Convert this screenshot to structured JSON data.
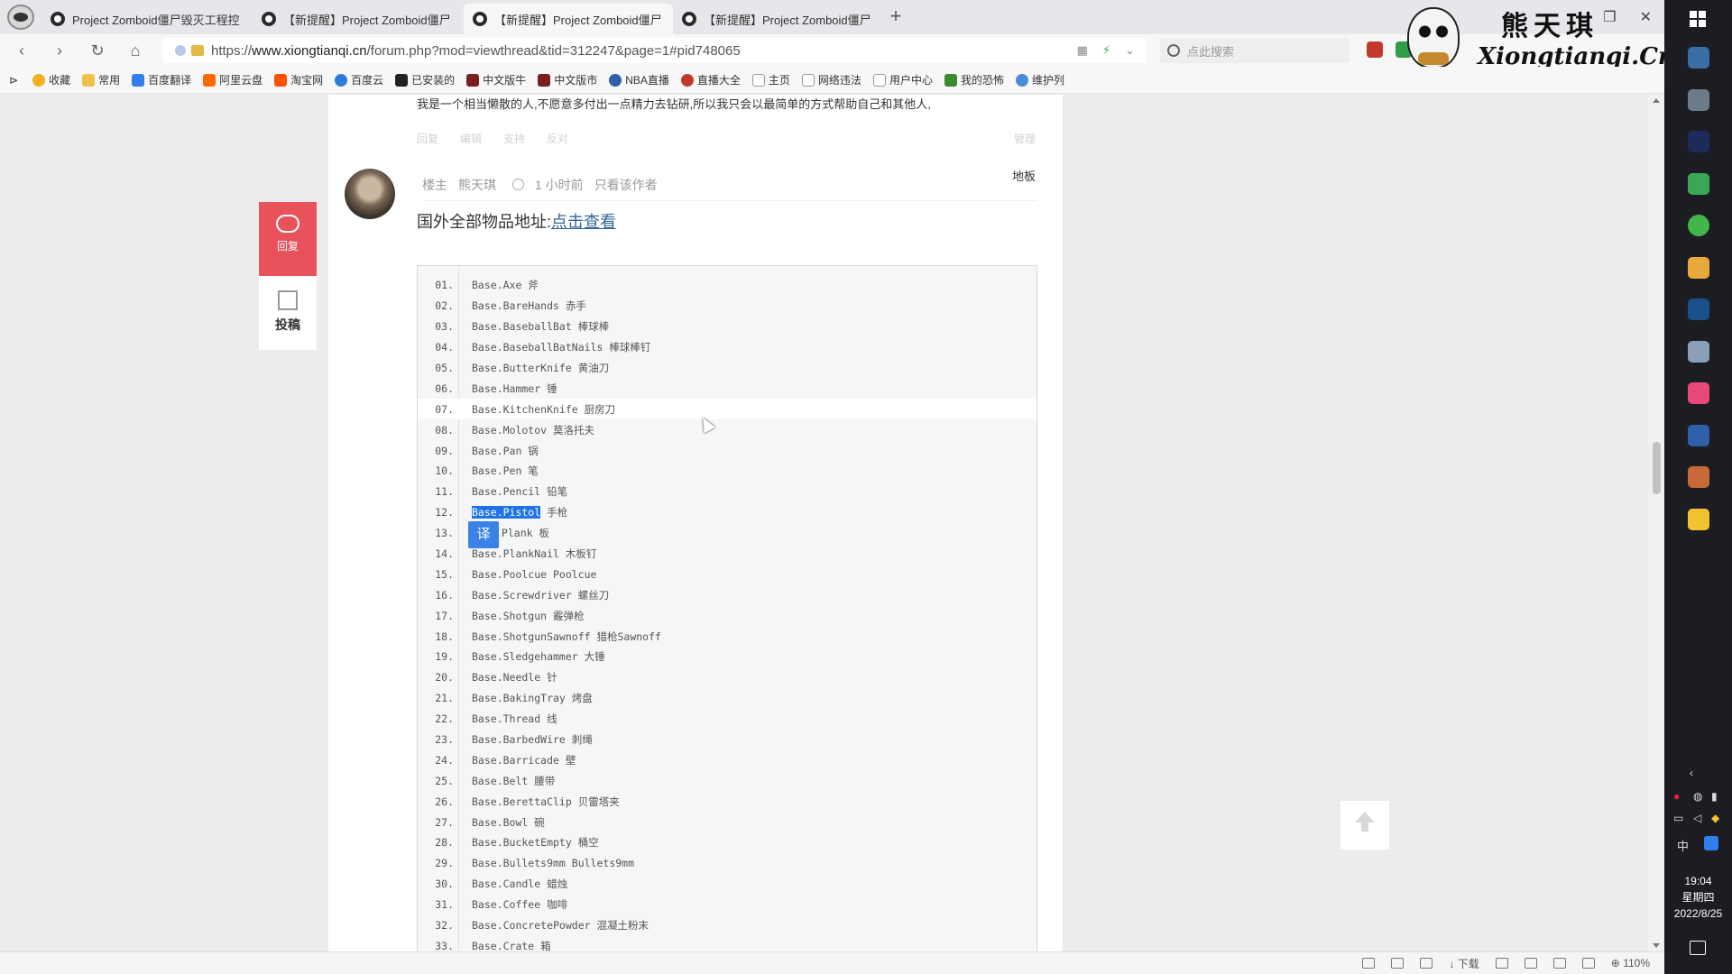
{
  "browser": {
    "tabs": [
      {
        "label": "Project Zomboid僵尸毁灭工程控"
      },
      {
        "label": "【新提醒】Project Zomboid僵尸"
      },
      {
        "label": "【新提醒】Project Zomboid僵尸"
      },
      {
        "label": "【新提醒】Project Zomboid僵尸"
      }
    ],
    "active_tab_index": 2,
    "url_host": "www.xiongtianqi.cn",
    "url_prefix": "https://",
    "url_path": "/forum.php?mod=viewthread&tid=312247&page=1#pid748065",
    "search_placeholder": "点此搜索",
    "bookmarks": [
      "收藏",
      "常用",
      "百度翻译",
      "阿里云盘",
      "淘宝网",
      "百度云",
      "已安装的",
      "中文版牛",
      "中文版市",
      "NBA直播",
      "直播大全",
      "主页",
      "网络违法",
      "用户中心",
      "我的恐怖",
      "维护列"
    ],
    "zoom": "110%",
    "download_label": "下载"
  },
  "watermark": {
    "title": "熊天琪",
    "url": "Xiongtianqi.Cn"
  },
  "page": {
    "prev_post_text": "我是一个相当懒散的人,不愿意多付出一点精力去钻研,所以我只会以最简单的方式帮助自己和其他人,",
    "prev_actions": [
      "回复",
      "编辑",
      "支持",
      "反对"
    ],
    "prev_manage": "管理",
    "meta": {
      "role": "楼主",
      "author": "熊天琪",
      "time": "1 小时前",
      "only_author": "只看该作者",
      "floor": "地板"
    },
    "body_label": "国外全部物品地址:",
    "body_link": "点击查看",
    "side_reply": "回复",
    "side_post": "投稿",
    "translate_badge": "译",
    "code_lines": [
      {
        "n": "01.",
        "t": "Base.Axe 斧"
      },
      {
        "n": "02.",
        "t": "Base.BareHands 赤手"
      },
      {
        "n": "03.",
        "t": "Base.BaseballBat 棒球棒"
      },
      {
        "n": "04.",
        "t": "Base.BaseballBatNails 棒球棒钉"
      },
      {
        "n": "05.",
        "t": "Base.ButterKnife 黄油刀"
      },
      {
        "n": "06.",
        "t": "Base.Hammer 锤"
      },
      {
        "n": "07.",
        "t": "Base.KitchenKnife 厨房刀"
      },
      {
        "n": "08.",
        "t": "Base.Molotov 莫洛托夫"
      },
      {
        "n": "09.",
        "t": "Base.Pan 锅"
      },
      {
        "n": "10.",
        "t": "Base.Pen 笔"
      },
      {
        "n": "11.",
        "t": "Base.Pencil 铅笔"
      },
      {
        "n": "12.",
        "t": " 手枪",
        "sel": "Base.Pistol"
      },
      {
        "n": "13.",
        "t": ".Plank 板"
      },
      {
        "n": "14.",
        "t": "Base.PlankNail 木板钉"
      },
      {
        "n": "15.",
        "t": "Base.Poolcue Poolcue"
      },
      {
        "n": "16.",
        "t": "Base.Screwdriver 螺丝刀"
      },
      {
        "n": "17.",
        "t": "Base.Shotgun 霰弹枪"
      },
      {
        "n": "18.",
        "t": "Base.ShotgunSawnoff 猎枪Sawnoff"
      },
      {
        "n": "19.",
        "t": "Base.Sledgehammer 大锤"
      },
      {
        "n": "20.",
        "t": "Base.Needle 针"
      },
      {
        "n": "21.",
        "t": "Base.BakingTray 烤盘"
      },
      {
        "n": "22.",
        "t": "Base.Thread 线"
      },
      {
        "n": "23.",
        "t": "Base.BarbedWire 刺绳"
      },
      {
        "n": "24.",
        "t": "Base.Barricade 壁"
      },
      {
        "n": "25.",
        "t": "Base.Belt 腰带"
      },
      {
        "n": "26.",
        "t": "Base.BerettaClip 贝雷塔夹"
      },
      {
        "n": "27.",
        "t": "Base.Bowl 碗"
      },
      {
        "n": "28.",
        "t": "Base.BucketEmpty 桶空"
      },
      {
        "n": "29.",
        "t": "Base.Bullets9mm Bullets9mm"
      },
      {
        "n": "30.",
        "t": "Base.Candle 蜡烛"
      },
      {
        "n": "31.",
        "t": "Base.Coffee 咖啡"
      },
      {
        "n": "32.",
        "t": "Base.ConcretePowder 混凝土粉末"
      },
      {
        "n": "33.",
        "t": "Base.Crate 箱"
      }
    ],
    "hovered_line_index": 6
  },
  "taskbar": {
    "ime": "中",
    "time": "19:04",
    "weekday": "星期四",
    "date": "2022/8/25",
    "app_icon_colors": [
      "#3a6ea5",
      "#6c7a89",
      "#1e2a5a",
      "#3aa757",
      "#43b649",
      "#e8a93a",
      "#1b4f8a",
      "#8aa0b8",
      "#e9497a",
      "#2f5fa8",
      "#c9693a",
      "#f2c230"
    ]
  }
}
